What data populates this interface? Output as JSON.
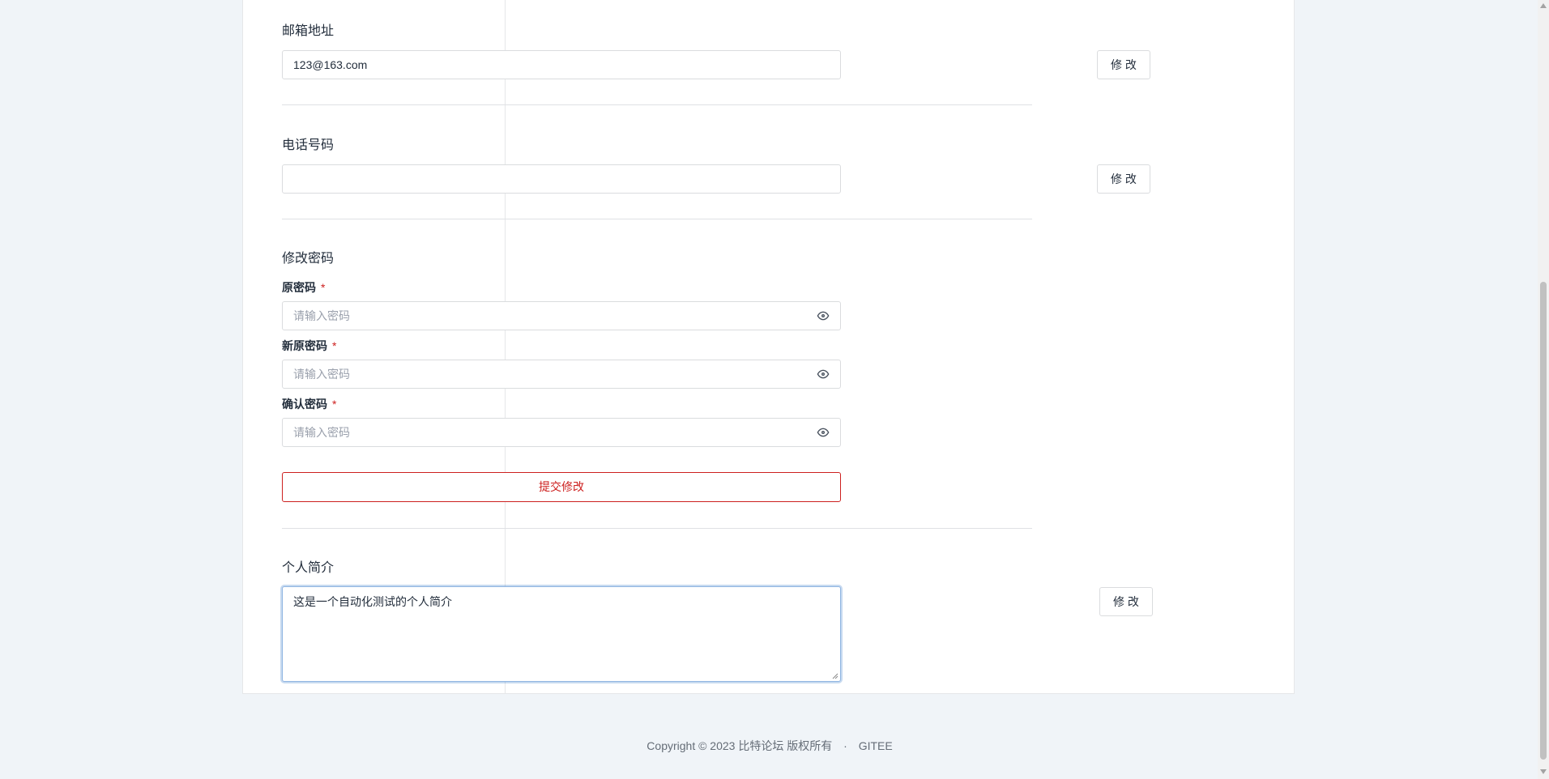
{
  "email": {
    "title": "邮箱地址",
    "value": "123@163.com",
    "button": "修 改"
  },
  "phone": {
    "title": "电话号码",
    "value": "",
    "button": "修 改"
  },
  "password": {
    "title": "修改密码",
    "fields": [
      {
        "label": "原密码",
        "required": "*",
        "placeholder": "请输入密码"
      },
      {
        "label": "新原密码",
        "required": "*",
        "placeholder": "请输入密码"
      },
      {
        "label": "确认密码",
        "required": "*",
        "placeholder": "请输入密码"
      }
    ],
    "submit": "提交修改"
  },
  "bio": {
    "title": "个人简介",
    "value": "这是一个自动化测试的个人简介",
    "button": "修 改"
  },
  "footer": {
    "copyright": "Copyright © 2023 比特论坛 版权所有",
    "separator": "·",
    "link": "GITEE"
  },
  "colors": {
    "accent_red": "#cd201f",
    "focus_blue": "#90b5e2",
    "background": "#f0f4f8"
  }
}
